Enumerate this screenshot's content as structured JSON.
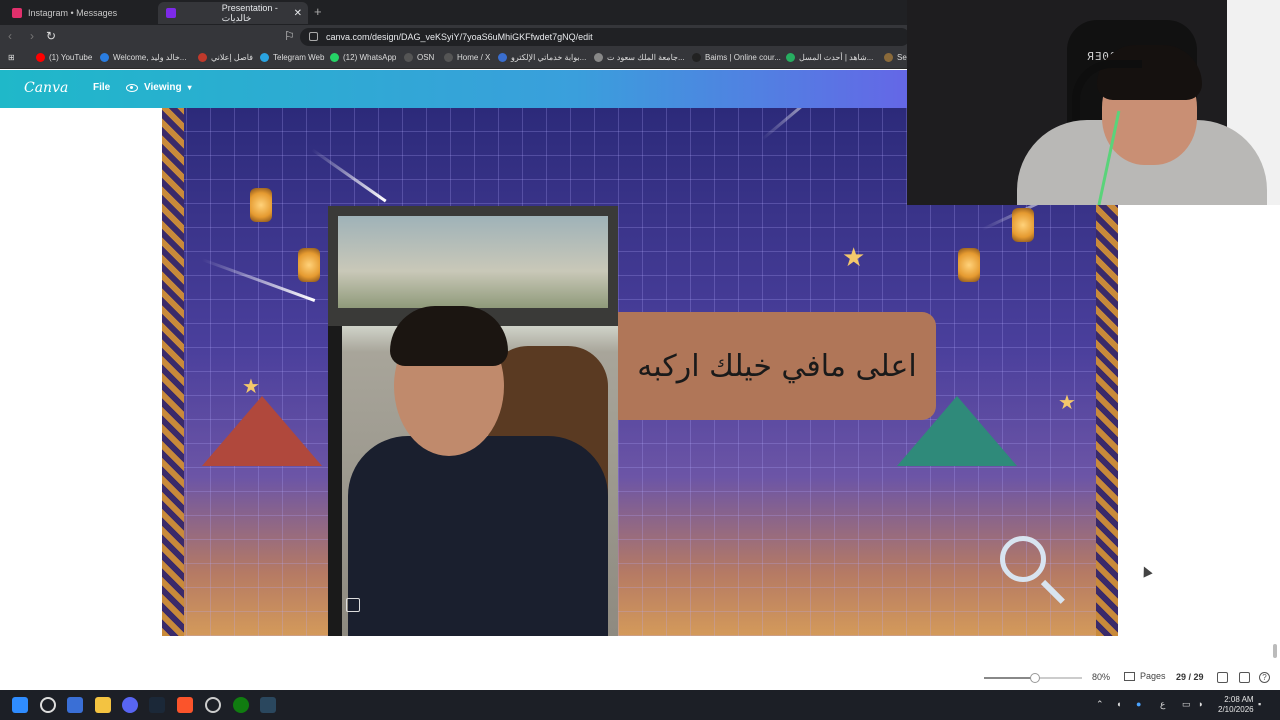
{
  "browser": {
    "tabs": [
      {
        "label": "Instagram • Messages",
        "color": "#e1306c",
        "active": false
      },
      {
        "label": "Presentation - خالديات",
        "color": "#7d2ae8",
        "active": true
      }
    ],
    "new_tab": "+",
    "url": "canva.com/design/DAG_veKSyiY/7yoaS6uMhiGKFfwdet7gNQ/edit",
    "bookmarks": [
      {
        "label": "(1) YouTube",
        "color": "#ff0000"
      },
      {
        "label": "Welcome, خالد وليد...",
        "color": "#2a7de1"
      },
      {
        "label": "فاصل إعلاني",
        "color": "#c0392b"
      },
      {
        "label": "Telegram Web",
        "color": "#2aa3e0"
      },
      {
        "label": "(12) WhatsApp",
        "color": "#25d366"
      },
      {
        "label": "OSN",
        "color": "#111111"
      },
      {
        "label": "Home / X",
        "color": "#111111"
      },
      {
        "label": "بوابة خدماتي الإلكترو...",
        "color": "#3a6ecf"
      },
      {
        "label": "جامعة الملك سعود ت...",
        "color": "#888888"
      },
      {
        "label": "Baims | Online cour...",
        "color": "#222222"
      },
      {
        "label": "شاهد | أحدث المسل...",
        "color": "#27ae60"
      },
      {
        "label": "See",
        "color": "#8a6a3a"
      }
    ]
  },
  "canva": {
    "logo": "Canva",
    "file_menu": "File",
    "viewing_menu": "Viewing",
    "caption": "اعلى مافي خيلك اركبه",
    "zoom": "80%",
    "zoom_level": 0.52,
    "pages_label": "Pages",
    "page_count": "29 / 29"
  },
  "webcam": {
    "chair_logo": "ЯƎ0ЯƎ"
  },
  "taskbar": {
    "time": "2:08 AM",
    "date": "2/10/2026",
    "lang": "ع"
  }
}
